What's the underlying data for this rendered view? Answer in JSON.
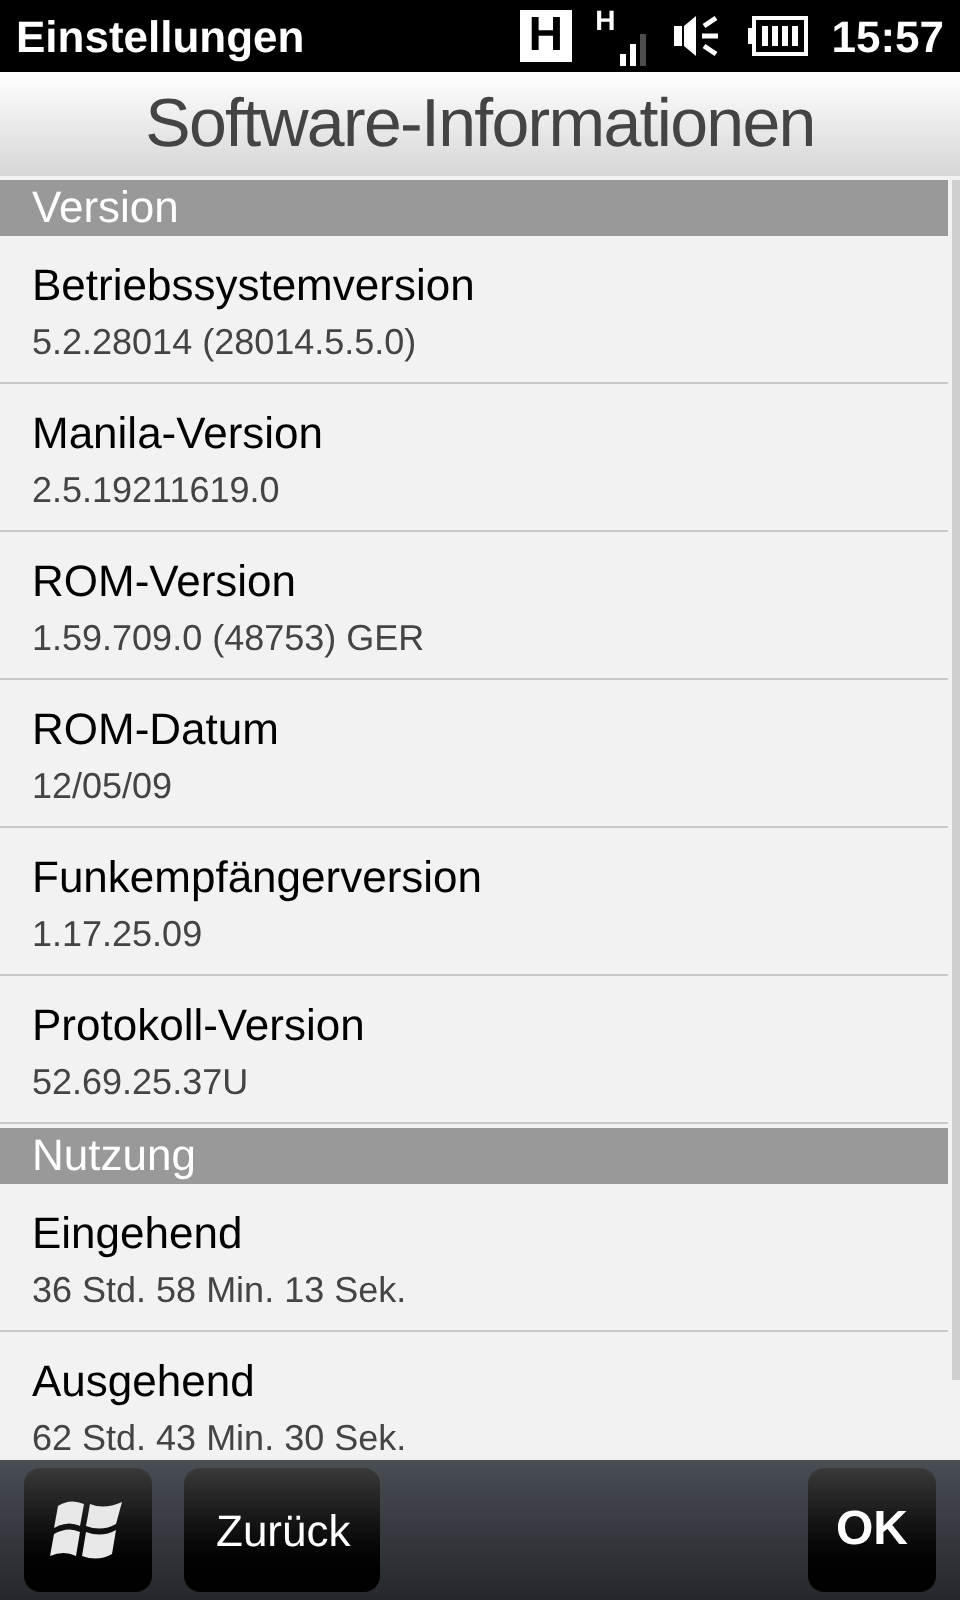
{
  "status_bar": {
    "title": "Einstellungen",
    "network_badge": "H",
    "signal_type": "H",
    "time": "15:57"
  },
  "page_title": "Software-Informationen",
  "sections": [
    {
      "title": "Version",
      "rows": [
        {
          "label": "Betriebssystemversion",
          "value": "5.2.28014 (28014.5.5.0)"
        },
        {
          "label": "Manila-Version",
          "value": "2.5.19211619.0"
        },
        {
          "label": "ROM-Version",
          "value": "1.59.709.0 (48753) GER"
        },
        {
          "label": "ROM-Datum",
          "value": "12/05/09"
        },
        {
          "label": "Funkempfängerversion",
          "value": "1.17.25.09"
        },
        {
          "label": "Protokoll-Version",
          "value": "52.69.25.37U"
        }
      ]
    },
    {
      "title": "Nutzung",
      "rows": [
        {
          "label": "Eingehend",
          "value": "36 Std. 58 Min. 13 Sek."
        },
        {
          "label": "Ausgehend",
          "value": "62 Std. 43 Min. 30 Sek."
        }
      ]
    }
  ],
  "bottom_bar": {
    "back": "Zurück",
    "ok": "OK"
  }
}
